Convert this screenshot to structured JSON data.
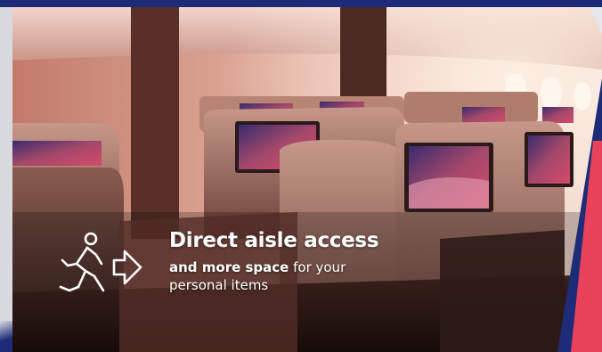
{
  "colors": {
    "brand_navy": "#1e2b78",
    "brand_coral": "#e8435a",
    "text_white": "#ffffff"
  },
  "feature": {
    "icon": "person-walking-arrow-icon",
    "headline": "Direct aisle access",
    "subline_bold": "and more space",
    "subline_regular_line1": " for your",
    "subline_line2": "personal items"
  }
}
